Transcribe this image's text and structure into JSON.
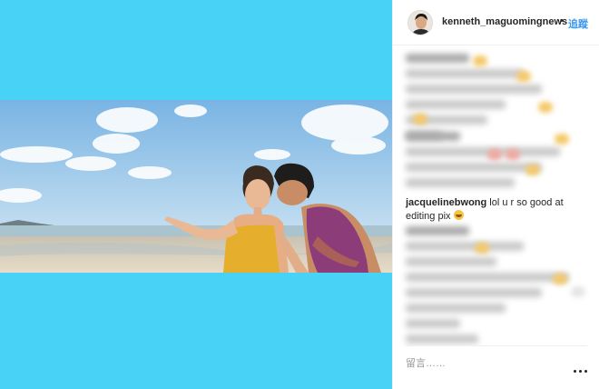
{
  "post": {
    "author": {
      "username": "kenneth_maguomingnews",
      "separator": "•",
      "follow_label": "追蹤"
    },
    "media": {
      "letterbox_color": "#48d2f5"
    },
    "visible_comment": {
      "author": "jacquelinebwong",
      "text": "lol u r so good at editing pix",
      "emoji": "grinning-face-icon"
    },
    "comment_box": {
      "placeholder": "留言……"
    },
    "more_options_icon": "ellipsis-icon"
  },
  "colors": {
    "link": "#3897f0",
    "text": "#262626",
    "placeholder": "#999999"
  }
}
